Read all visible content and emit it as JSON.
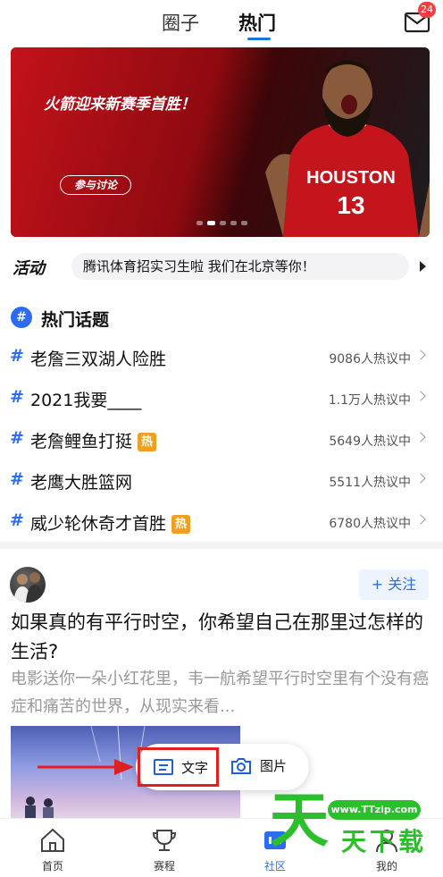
{
  "topnav": {
    "tabs": [
      "圈子",
      "热门"
    ],
    "active_tab": "热门",
    "mail_badge": "24"
  },
  "banner": {
    "title": "火箭迎来新赛季首胜！",
    "button": "参与讨论",
    "jersey_text": "HOUSTON",
    "jersey_number": "13",
    "slides": 5,
    "active_slide": 1
  },
  "activity": {
    "label": "活动",
    "text": "腾讯体育招实习生啦 我们在北京等你！"
  },
  "hot_topics": {
    "title": "热门话题",
    "items": [
      {
        "name": "老詹三双湖人险胜",
        "count": "9086人热议中",
        "hot": false
      },
      {
        "name": "2021我要____",
        "count": "1.1万人热议中",
        "hot": false
      },
      {
        "name": "老詹鲤鱼打挺",
        "count": "5649人热议中",
        "hot": true
      },
      {
        "name": "老鹰大胜篮网",
        "count": "5511人热议中",
        "hot": false
      },
      {
        "name": "威少轮休奇才首胜",
        "count": "6780人热议中",
        "hot": true
      }
    ],
    "hot_tag": "热"
  },
  "post": {
    "follow": "+ 关注",
    "title": "如果真的有平行时空，你希望自己在那里过怎样的生活?",
    "excerpt": "电影送你一朵小红花里，韦一航希望平行时空里有个没有癌症和痛苦的世界，从现实来看..."
  },
  "popup": {
    "text_option": "文字",
    "image_option": "图片"
  },
  "bottom_nav": [
    "首页",
    "赛程",
    "社区",
    "我的"
  ],
  "active_nav": "社区",
  "watermark": {
    "url": "www.TTzip.com",
    "big": "天",
    "small": "天下载"
  },
  "colors": {
    "accent": "#2b6cf0",
    "hot_tag": "#f0a020",
    "highlight_box": "#e02020",
    "watermark": "#2bc02b"
  }
}
